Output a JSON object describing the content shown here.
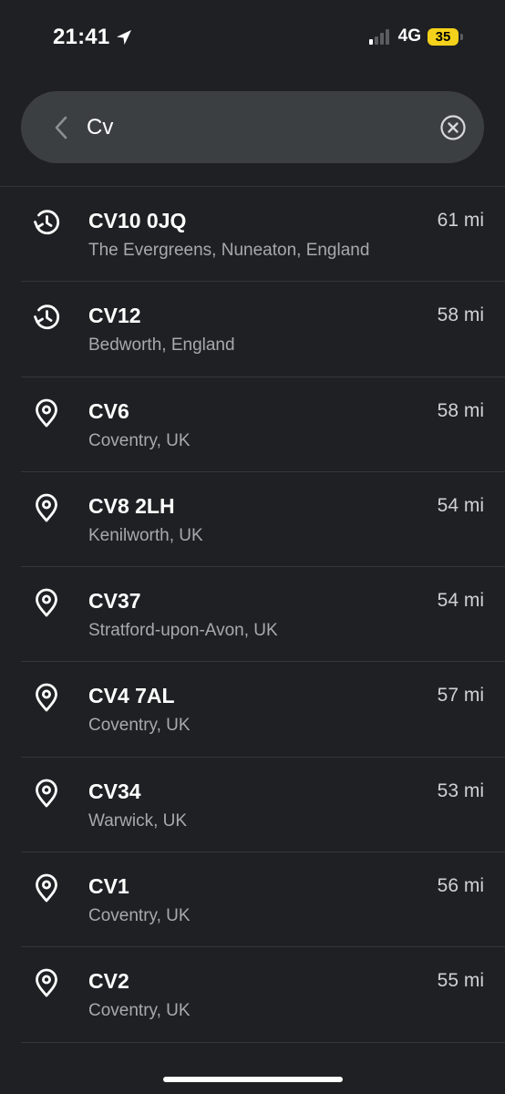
{
  "status_bar": {
    "time": "21:41",
    "network": "4G",
    "battery": "35",
    "signal_bars_active": 1,
    "signal_bars_total": 4
  },
  "search": {
    "query": "Cv",
    "back_icon": "chevron-left-icon",
    "clear_icon": "clear-circle-icon"
  },
  "results": [
    {
      "icon": "history-icon",
      "title": "CV10 0JQ",
      "subtitle": "The Evergreens, Nuneaton, England",
      "distance": "61 mi"
    },
    {
      "icon": "history-icon",
      "title": "CV12",
      "subtitle": "Bedworth, England",
      "distance": "58 mi"
    },
    {
      "icon": "location-pin-icon",
      "title": "CV6",
      "subtitle": "Coventry, UK",
      "distance": "58 mi"
    },
    {
      "icon": "location-pin-icon",
      "title": "CV8 2LH",
      "subtitle": "Kenilworth, UK",
      "distance": "54 mi"
    },
    {
      "icon": "location-pin-icon",
      "title": "CV37",
      "subtitle": "Stratford-upon-Avon, UK",
      "distance": "54 mi"
    },
    {
      "icon": "location-pin-icon",
      "title": "CV4 7AL",
      "subtitle": "Coventry, UK",
      "distance": "57 mi"
    },
    {
      "icon": "location-pin-icon",
      "title": "CV34",
      "subtitle": "Warwick, UK",
      "distance": "53 mi"
    },
    {
      "icon": "location-pin-icon",
      "title": "CV1",
      "subtitle": "Coventry, UK",
      "distance": "56 mi"
    },
    {
      "icon": "location-pin-icon",
      "title": "CV2",
      "subtitle": "Coventry, UK",
      "distance": "55 mi"
    }
  ],
  "colors": {
    "background": "#1f2023",
    "search_bar": "#3c3f42",
    "battery": "#f4d21b",
    "subtitle_text": "#a7a9ad"
  }
}
